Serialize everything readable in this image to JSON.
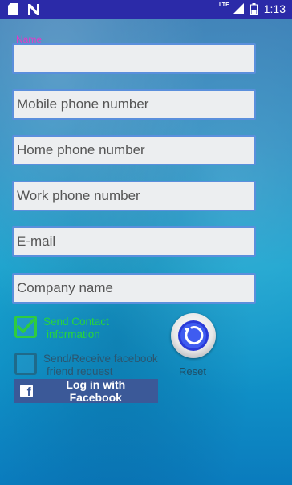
{
  "status_bar": {
    "time": "1:13",
    "network": "LTE",
    "icons": [
      "sd-card-icon",
      "notification-n-icon",
      "signal-icon",
      "battery-icon"
    ]
  },
  "form": {
    "name_label": "Name",
    "name_value": "",
    "mobile_placeholder": "Mobile phone number",
    "home_placeholder": "Home phone number",
    "work_placeholder": "Work phone number",
    "email_placeholder": "E-mail",
    "company_placeholder": "Company name"
  },
  "options": {
    "send_contact": {
      "line1": "Send Contact",
      "line2": "information",
      "checked": true
    },
    "facebook_friend": {
      "line1": "Send/Receive facebook",
      "line2": "friend request",
      "checked": false
    }
  },
  "reset": {
    "label": "Reset"
  },
  "facebook": {
    "button_label": "Log in with Facebook"
  },
  "colors": {
    "status_bar": "#2b2aa8",
    "label": "#e03cc8",
    "field_border": "#5a8fdc",
    "check_on": "#27d43c",
    "facebook": "#3b5998"
  }
}
